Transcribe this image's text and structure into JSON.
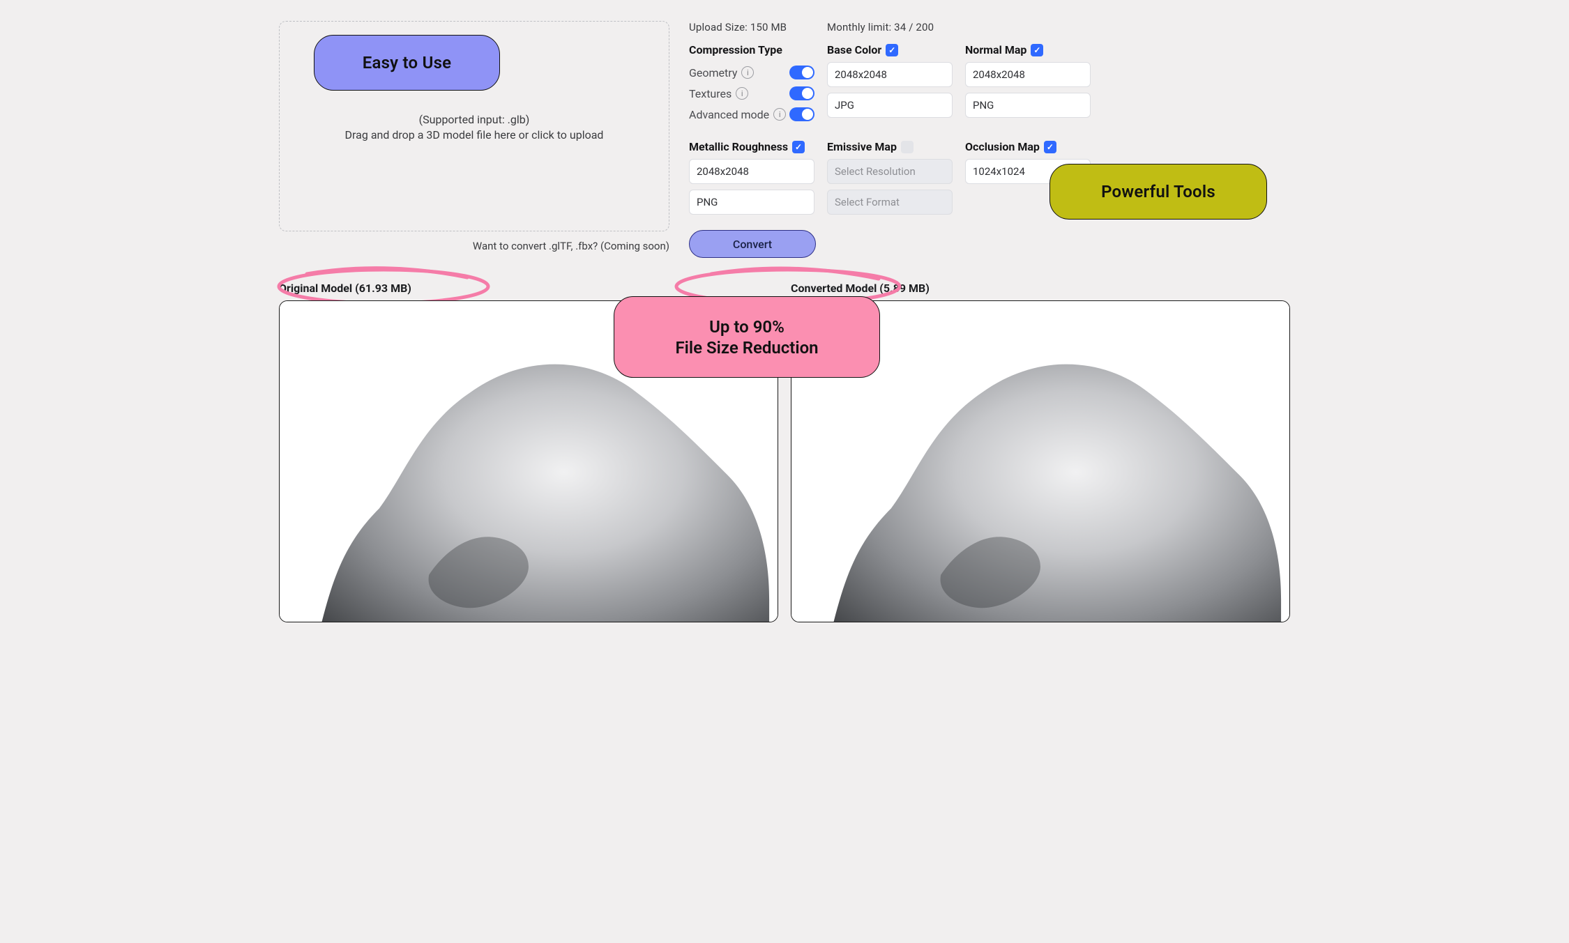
{
  "upload": {
    "supported_text": "(Supported input: .glb)",
    "drag_text": "Drag and drop a 3D model file here or click to upload",
    "coming_soon": "Want to convert .glTF, .fbx? (Coming soon)",
    "upload_size_label": "Upload Size: 150 MB",
    "monthly_limit_label": "Monthly limit: 34 / 200"
  },
  "settings": {
    "compression_type": {
      "title": "Compression Type",
      "rows": {
        "geometry": {
          "label": "Geometry",
          "on": true
        },
        "textures": {
          "label": "Textures",
          "on": true
        },
        "advanced": {
          "label": "Advanced mode",
          "on": true
        }
      }
    },
    "base_color": {
      "title": "Base Color",
      "checked": true,
      "resolution": "2048x2048",
      "format": "JPG"
    },
    "normal_map": {
      "title": "Normal Map",
      "checked": true,
      "resolution": "2048x2048",
      "format": "PNG"
    },
    "metallic_roughness": {
      "title": "Metallic Roughness",
      "checked": true,
      "resolution": "2048x2048",
      "format": "PNG"
    },
    "emissive_map": {
      "title": "Emissive Map",
      "checked": false,
      "resolution_placeholder": "Select Resolution",
      "format_placeholder": "Select Format"
    },
    "occlusion_map": {
      "title": "Occlusion Map",
      "checked": true,
      "resolution": "1024x1024"
    },
    "convert_button": "Convert"
  },
  "callouts": {
    "easy": "Easy to Use",
    "powerful": "Powerful Tools",
    "reduction_line1": "Up to 90%",
    "reduction_line2": "File Size Reduction"
  },
  "compare": {
    "original_label": "Original Model (61.93 MB)",
    "converted_label": "Converted Model (5.89 MB)"
  },
  "colors": {
    "blue": "#2f69ff",
    "periwinkle": "#8f93f6",
    "olive": "#c0bd14",
    "pink": "#fb8fb1"
  }
}
